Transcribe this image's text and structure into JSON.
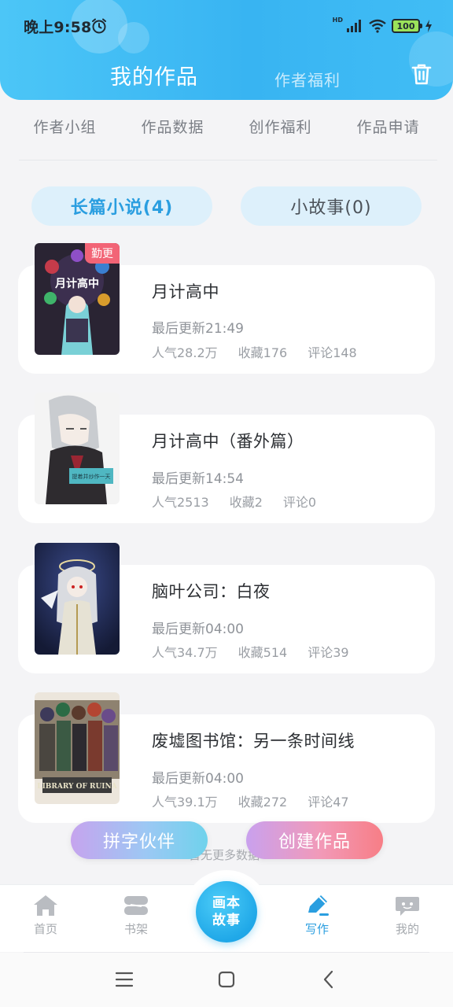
{
  "status_bar": {
    "time": "晚上9:58",
    "network_label": "HD",
    "battery": "100"
  },
  "header": {
    "title": "我的作品",
    "secondary_tab": "作者福利"
  },
  "menu": {
    "items": [
      "作者小组",
      "作品数据",
      "创作福利",
      "作品申请"
    ]
  },
  "categories": {
    "long": "长篇小说(4)",
    "short": "小故事(0)"
  },
  "works": [
    {
      "title": "月计高中",
      "updated": "最后更新21:49",
      "popularity": "人气28.2万",
      "favorites": "收藏176",
      "comments": "评论148",
      "badge": "勤更",
      "cover_text": "月计高中"
    },
    {
      "title": "月计高中（番外篇）",
      "updated": "最后更新14:54",
      "popularity": "人气2513",
      "favorites": "收藏2",
      "comments": "评论0",
      "cover_text": "提着并炒作一天"
    },
    {
      "title": "脑叶公司：白夜",
      "updated": "最后更新04:00",
      "popularity": "人气34.7万",
      "favorites": "收藏514",
      "comments": "评论39"
    },
    {
      "title": "废墟图书馆：另一条时间线",
      "updated": "最后更新04:00",
      "popularity": "人气39.1万",
      "favorites": "收藏272",
      "comments": "评论47",
      "cover_text": "LIBRARY OF RUINA"
    }
  ],
  "footer_hint": "暂无更多数据",
  "buttons": {
    "partner": "拼字伙伴",
    "create": "创建作品"
  },
  "bottom_nav": {
    "home": "首页",
    "shelf": "书架",
    "center_line1": "画本",
    "center_line2": "故事",
    "write": "写作",
    "mine": "我的"
  },
  "colors": {
    "accent": "#2a9ee0",
    "header_gradient": [
      "#4cc6f7",
      "#38b4f2"
    ],
    "badge": "#f26476"
  }
}
